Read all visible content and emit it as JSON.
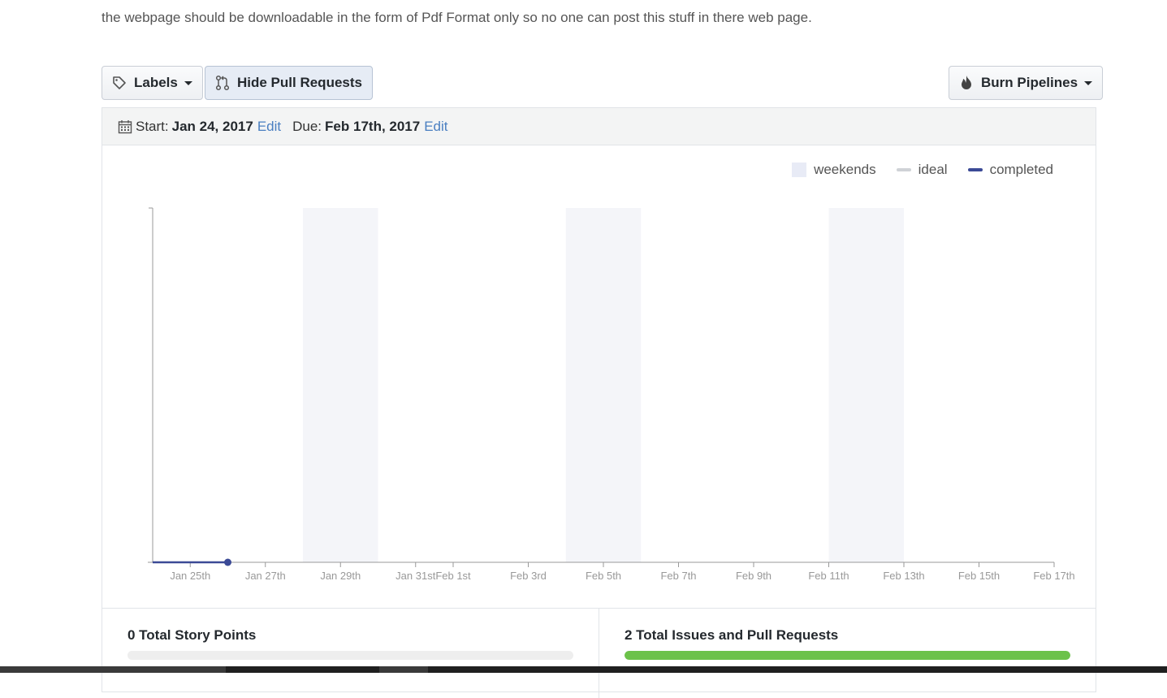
{
  "description": "the webpage should be downloadable in the form of Pdf Format only so no one can post this stuff in there web page.",
  "toolbar": {
    "labels_button": "Labels",
    "hide_prs_button": "Hide Pull Requests",
    "burn_pipelines_button": "Burn Pipelines"
  },
  "milestone": {
    "start_label": "Start:",
    "start_date": "Jan 24, 2017",
    "start_edit": "Edit",
    "due_label": "Due:",
    "due_date": "Feb 17th, 2017",
    "due_edit": "Edit"
  },
  "legend": {
    "weekends": "weekends",
    "ideal": "ideal",
    "completed": "completed"
  },
  "chart_data": {
    "type": "line",
    "title": "",
    "xlabel": "",
    "ylabel": "",
    "x_domain": [
      "2017-01-24",
      "2017-02-17"
    ],
    "x_ticks": [
      {
        "date": "2017-01-25",
        "label": "Jan 25th"
      },
      {
        "date": "2017-01-27",
        "label": "Jan 27th"
      },
      {
        "date": "2017-01-29",
        "label": "Jan 29th"
      },
      {
        "date": "2017-01-31",
        "label": "Jan 31st"
      },
      {
        "date": "2017-02-01",
        "label": "Feb 1st"
      },
      {
        "date": "2017-02-03",
        "label": "Feb 3rd"
      },
      {
        "date": "2017-02-05",
        "label": "Feb 5th"
      },
      {
        "date": "2017-02-07",
        "label": "Feb 7th"
      },
      {
        "date": "2017-02-09",
        "label": "Feb 9th"
      },
      {
        "date": "2017-02-11",
        "label": "Feb 11th"
      },
      {
        "date": "2017-02-13",
        "label": "Feb 13th"
      },
      {
        "date": "2017-02-15",
        "label": "Feb 15th"
      },
      {
        "date": "2017-02-17",
        "label": "Feb 17th"
      }
    ],
    "weekends": [
      {
        "start": "2017-01-28",
        "end": "2017-01-30"
      },
      {
        "start": "2017-02-04",
        "end": "2017-02-06"
      },
      {
        "start": "2017-02-11",
        "end": "2017-02-13"
      }
    ],
    "series": [
      {
        "name": "completed",
        "points": [
          {
            "x": "2017-01-24",
            "y": 0
          },
          {
            "x": "2017-01-26",
            "y": 0
          }
        ]
      }
    ],
    "y_tick_labels": false,
    "grid": false,
    "legend_position": "top-right",
    "colors": {
      "weekend": "#f4f5f9",
      "completed": "#3b4a96",
      "axis": "#999999"
    }
  },
  "stats": {
    "story_points": {
      "title": "0 Total Story Points",
      "progress": 0
    },
    "issues": {
      "title": "2 Total Issues and Pull Requests",
      "progress": 1
    }
  }
}
